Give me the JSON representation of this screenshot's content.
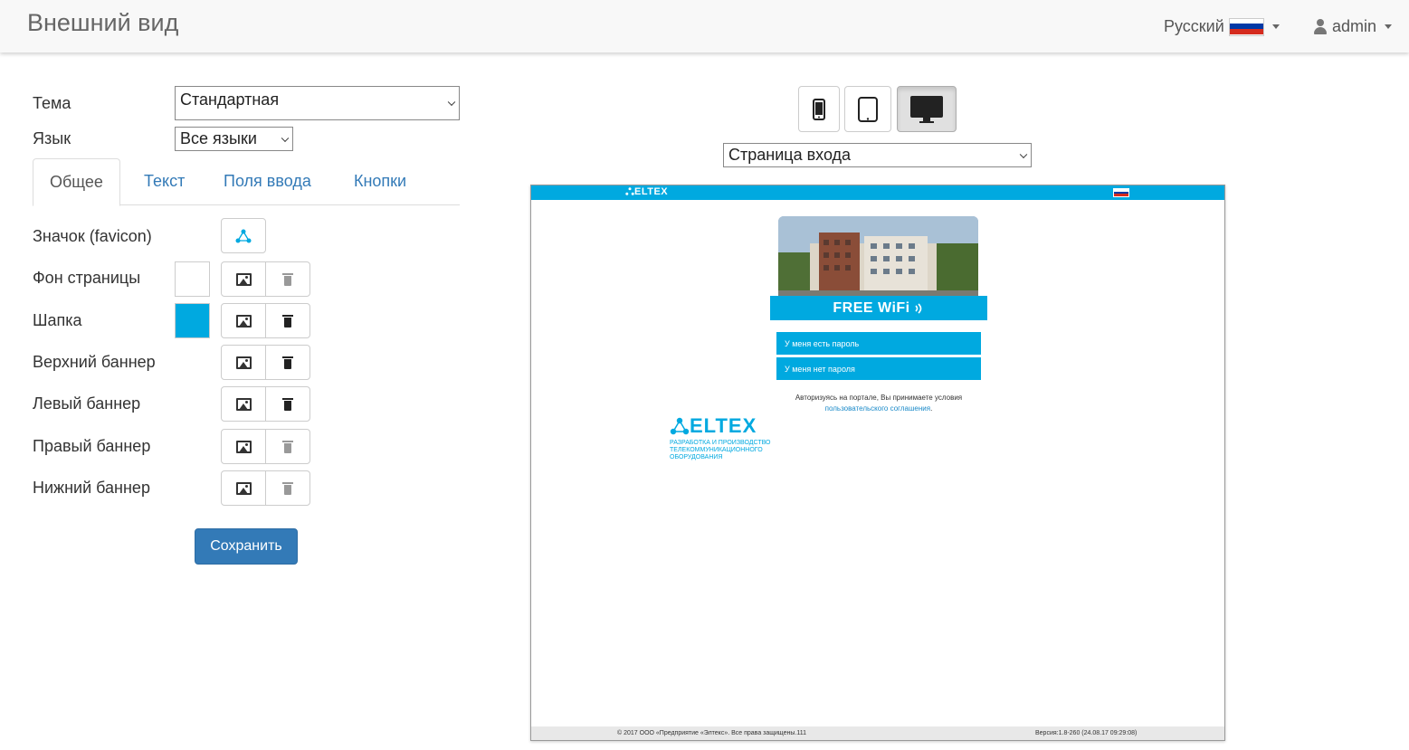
{
  "header": {
    "title": "Внешний вид",
    "language": "Русский",
    "user": "admin",
    "flag_colors": [
      "#ffffff",
      "#0039a6",
      "#d52b1e"
    ]
  },
  "form": {
    "theme_label": "Тема",
    "theme_value": "Стандартная",
    "language_label": "Язык",
    "language_value": "Все языки",
    "tabs": [
      {
        "label": "Общее",
        "active": true
      },
      {
        "label": "Текст",
        "active": false
      },
      {
        "label": "Поля ввода",
        "active": false
      },
      {
        "label": "Кнопки",
        "active": false
      }
    ],
    "rows": {
      "favicon": "Значок (favicon)",
      "page_bg": "Фон страницы",
      "header": "Шапка",
      "top_banner": "Верхний баннер",
      "left_banner": "Левый баннер",
      "right_banner": "Правый баннер",
      "bottom_banner": "Нижний баннер"
    },
    "page_bg_color": "#ffffff",
    "header_color": "#00a9e0",
    "save_label": "Сохранить"
  },
  "preview": {
    "page_select": "Страница входа",
    "header_logo": "ELTEX",
    "wifi_text": "FREE WiFi",
    "btn_have_password": "У меня есть пароль",
    "btn_no_password": "У меня нет пароля",
    "terms_text": "Авторизуясь на портале, Вы принимаете условия",
    "terms_link": "пользовательского соглашения",
    "terms_end": ".",
    "logo_text": "ELTEX",
    "logo_sub": "РАЗРАБОТКА И ПРОИЗВОДСТВО ТЕЛЕКОММУНИКАЦИОННОГО ОБОРУДОВАНИЯ",
    "footer_left": "© 2017 ООО «Предприятие «Элтекс». Все права защищены.111",
    "footer_right": "Версия:1.8-260 (24.08.17 09:29:08)",
    "accent": "#00a9e0"
  }
}
